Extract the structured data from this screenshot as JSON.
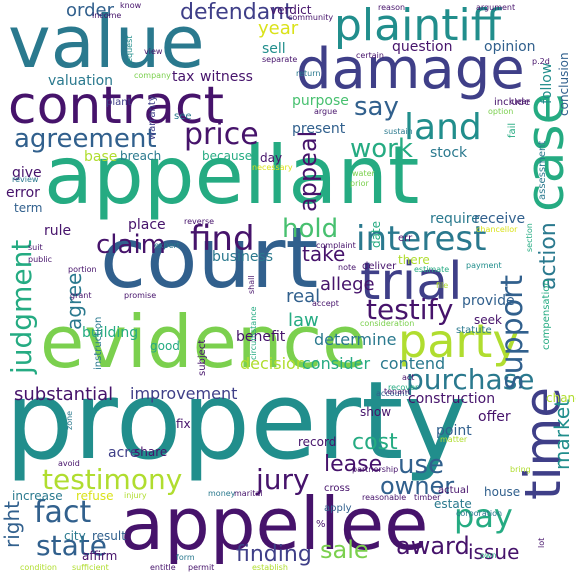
{
  "palette": {
    "dark_purple": "#46136b",
    "indigo": "#3f3f88",
    "blue": "#31608d",
    "teal_blue": "#2a798e",
    "teal": "#218e8c",
    "sea_green": "#25ab82",
    "green": "#47c06f",
    "light_green": "#7bd04e",
    "yellow_green": "#b0dd2f",
    "yellow": "#dae21a"
  },
  "words": [
    {
      "text": "value",
      "color": "#2a798e"
    },
    {
      "text": "property",
      "color": "#218e8c"
    },
    {
      "text": "appellant",
      "color": "#25ab82"
    },
    {
      "text": "court",
      "color": "#31608d"
    },
    {
      "text": "evidence",
      "color": "#7bd04e"
    },
    {
      "text": "appellee",
      "color": "#46136b"
    },
    {
      "text": "damage",
      "color": "#3f3f88"
    },
    {
      "text": "contract",
      "color": "#46136b"
    },
    {
      "text": "plaintiff",
      "color": "#218e8c"
    },
    {
      "text": "trial",
      "color": "#3f3f88"
    },
    {
      "text": "case",
      "color": "#25ab82"
    },
    {
      "text": "party",
      "color": "#b0dd2f"
    },
    {
      "text": "interest",
      "color": "#2a798e"
    },
    {
      "text": "time",
      "color": "#3f3f88"
    },
    {
      "text": "find",
      "color": "#46136b"
    },
    {
      "text": "agreement",
      "color": "#31608d"
    },
    {
      "text": "land",
      "color": "#218e8c"
    },
    {
      "text": "testimony",
      "color": "#b0dd2f"
    },
    {
      "text": "jury",
      "color": "#46136b"
    },
    {
      "text": "purchase",
      "color": "#2a798e"
    },
    {
      "text": "support",
      "color": "#31608d"
    },
    {
      "text": "testify",
      "color": "#46136b"
    },
    {
      "text": "judgment",
      "color": "#25ab82"
    },
    {
      "text": "price",
      "color": "#46136b"
    },
    {
      "text": "fact",
      "color": "#31608d"
    },
    {
      "text": "state",
      "color": "#31608d"
    },
    {
      "text": "pay",
      "color": "#25ab82"
    },
    {
      "text": "claim",
      "color": "#46136b"
    },
    {
      "text": "hold",
      "color": "#47c06f"
    },
    {
      "text": "work",
      "color": "#25ab82"
    },
    {
      "text": "say",
      "color": "#31608d"
    },
    {
      "text": "appeal",
      "color": "#46136b"
    },
    {
      "text": "owner",
      "color": "#31608d"
    },
    {
      "text": "use",
      "color": "#31608d"
    },
    {
      "text": "cost",
      "color": "#25ab82"
    },
    {
      "text": "lease",
      "color": "#46136b"
    },
    {
      "text": "action",
      "color": "#2a798e"
    },
    {
      "text": "sale",
      "color": "#7bd04e"
    },
    {
      "text": "award",
      "color": "#46136b"
    },
    {
      "text": "issue",
      "color": "#46136b"
    },
    {
      "text": "market",
      "color": "#218e8c"
    },
    {
      "text": "right",
      "color": "#31608d"
    },
    {
      "text": "finding",
      "color": "#3f3f88"
    },
    {
      "text": "defendant",
      "color": "#3f3f88"
    },
    {
      "text": "order",
      "color": "#31608d"
    },
    {
      "text": "year",
      "color": "#dae21a"
    },
    {
      "text": "take",
      "color": "#46136b"
    },
    {
      "text": "allege",
      "color": "#46136b"
    },
    {
      "text": "agree",
      "color": "#2a798e"
    },
    {
      "text": "law",
      "color": "#25ab82"
    },
    {
      "text": "real",
      "color": "#31608d"
    },
    {
      "text": "substantial",
      "color": "#46136b"
    },
    {
      "text": "improvement",
      "color": "#3f3f88"
    },
    {
      "text": "decision",
      "color": "#b0dd2f"
    },
    {
      "text": "consider",
      "color": "#25ab82"
    },
    {
      "text": "determine",
      "color": "#2a798e"
    },
    {
      "text": "contend",
      "color": "#2a798e"
    },
    {
      "text": "construction",
      "color": "#46136b"
    },
    {
      "text": "question",
      "color": "#46136b"
    },
    {
      "text": "opinion",
      "color": "#31608d"
    },
    {
      "text": "sell",
      "color": "#218e8c"
    },
    {
      "text": "valuation",
      "color": "#2a798e"
    },
    {
      "text": "tax",
      "color": "#46136b"
    },
    {
      "text": "witness",
      "color": "#46136b"
    },
    {
      "text": "purpose",
      "color": "#47c06f"
    },
    {
      "text": "present",
      "color": "#31608d"
    },
    {
      "text": "stock",
      "color": "#2a798e"
    },
    {
      "text": "base",
      "color": "#b0dd2f"
    },
    {
      "text": "breach",
      "color": "#2a798e"
    },
    {
      "text": "because",
      "color": "#25ab82"
    },
    {
      "text": "day",
      "color": "#46136b"
    },
    {
      "text": "give",
      "color": "#46136b"
    },
    {
      "text": "error",
      "color": "#46136b"
    },
    {
      "text": "term",
      "color": "#31608d"
    },
    {
      "text": "rule",
      "color": "#46136b"
    },
    {
      "text": "place",
      "color": "#46136b"
    },
    {
      "text": "business",
      "color": "#2a798e"
    },
    {
      "text": "require",
      "color": "#2a798e"
    },
    {
      "text": "receive",
      "color": "#31608d"
    },
    {
      "text": "follow",
      "color": "#218e8c"
    },
    {
      "text": "conclusion",
      "color": "#31608d"
    },
    {
      "text": "building",
      "color": "#25ab82"
    },
    {
      "text": "benefit",
      "color": "#46136b"
    },
    {
      "text": "good",
      "color": "#25ab82"
    },
    {
      "text": "offer",
      "color": "#46136b"
    },
    {
      "text": "record",
      "color": "#46136b"
    },
    {
      "text": "show",
      "color": "#46136b"
    },
    {
      "text": "point",
      "color": "#31608d"
    },
    {
      "text": "acre",
      "color": "#3f3f88"
    },
    {
      "text": "share",
      "color": "#46136b"
    },
    {
      "text": "fix",
      "color": "#46136b"
    },
    {
      "text": "increase",
      "color": "#2a798e"
    },
    {
      "text": "refuse",
      "color": "#dae21a"
    },
    {
      "text": "city",
      "color": "#2a798e"
    },
    {
      "text": "result",
      "color": "#31608d"
    },
    {
      "text": "affirm",
      "color": "#46136b"
    },
    {
      "text": "house",
      "color": "#31608d"
    },
    {
      "text": "actual",
      "color": "#46136b"
    },
    {
      "text": "estate",
      "color": "#2a798e"
    },
    {
      "text": "provide",
      "color": "#31608d"
    },
    {
      "text": "change",
      "color": "#b0dd2f"
    },
    {
      "text": "seek",
      "color": "#46136b"
    },
    {
      "text": "compensation",
      "color": "#25ab82"
    },
    {
      "text": "verdict",
      "color": "#46136b"
    },
    {
      "text": "community",
      "color": "#46136b"
    },
    {
      "text": "argument",
      "color": "#46136b"
    },
    {
      "text": "include",
      "color": "#46136b"
    },
    {
      "text": "option",
      "color": "#7bd04e"
    },
    {
      "text": "return",
      "color": "#2a798e"
    },
    {
      "text": "plant",
      "color": "#3f3f88"
    },
    {
      "text": "warranty",
      "color": "#3f3f88"
    },
    {
      "text": "see",
      "color": "#2a798e"
    },
    {
      "text": "assessment",
      "color": "#2a798e"
    },
    {
      "text": "instruction",
      "color": "#2a798e"
    },
    {
      "text": "accept",
      "color": "#46136b"
    },
    {
      "text": "subject",
      "color": "#46136b"
    },
    {
      "text": "condition",
      "color": "#b0dd2f"
    },
    {
      "text": "sufficient",
      "color": "#b0dd2f"
    },
    {
      "text": "entitle",
      "color": "#46136b"
    },
    {
      "text": "permit",
      "color": "#46136b"
    },
    {
      "text": "form",
      "color": "#2a798e"
    },
    {
      "text": "establish",
      "color": "#b0dd2f"
    },
    {
      "text": "statute",
      "color": "#2a798e"
    },
    {
      "text": "account",
      "color": "#31608d"
    },
    {
      "text": "note",
      "color": "#46136b"
    },
    {
      "text": "deliver",
      "color": "#46136b"
    },
    {
      "text": "date",
      "color": "#25ab82"
    },
    {
      "text": "there",
      "color": "#b0dd2f"
    },
    {
      "text": "err",
      "color": "#46136b"
    },
    {
      "text": "reverse",
      "color": "#46136b"
    },
    {
      "text": "partnership",
      "color": "#46136b"
    },
    {
      "text": "reasonable",
      "color": "#46136b"
    },
    {
      "text": "timber",
      "color": "#46136b"
    },
    {
      "text": "corporation",
      "color": "#2a798e"
    },
    {
      "text": "cross",
      "color": "#46136b"
    },
    {
      "text": "apply",
      "color": "#31608d"
    },
    {
      "text": "shall",
      "color": "#46136b"
    },
    {
      "text": "expert",
      "color": "#2a798e"
    },
    {
      "text": "public",
      "color": "#46136b"
    },
    {
      "text": "suit",
      "color": "#46136b"
    },
    {
      "text": "grant",
      "color": "#46136b"
    },
    {
      "text": "portion",
      "color": "#46136b"
    },
    {
      "text": "complaint",
      "color": "#46136b"
    },
    {
      "text": "estimate",
      "color": "#25ab82"
    },
    {
      "text": "payment",
      "color": "#218e8c"
    },
    {
      "text": "section",
      "color": "#25ab82"
    },
    {
      "text": "injury",
      "color": "#b0dd2f"
    },
    {
      "text": "money",
      "color": "#2a798e"
    },
    {
      "text": "marital",
      "color": "#46136b"
    },
    {
      "text": "own",
      "color": "#25ab82"
    },
    {
      "text": "lot",
      "color": "#46136b"
    },
    {
      "text": "circumstance",
      "color": "#25ab82"
    },
    {
      "text": "income",
      "color": "#46136b"
    },
    {
      "text": "know",
      "color": "#46136b"
    },
    {
      "text": "request",
      "color": "#218e8c"
    },
    {
      "text": "view",
      "color": "#46136b"
    },
    {
      "text": "company",
      "color": "#7bd04e"
    },
    {
      "text": "separate",
      "color": "#46136b"
    },
    {
      "text": "certain",
      "color": "#46136b"
    },
    {
      "text": "argue",
      "color": "#46136b"
    },
    {
      "text": "sustain",
      "color": "#2a798e"
    },
    {
      "text": "fail",
      "color": "#25ab82"
    },
    {
      "text": "prior",
      "color": "#7bd04e"
    },
    {
      "text": "water",
      "color": "#7bd04e"
    },
    {
      "text": "chancellor",
      "color": "#dae21a"
    },
    {
      "text": "necessary",
      "color": "#dae21a"
    },
    {
      "text": "review",
      "color": "#2a798e"
    },
    {
      "text": "clear",
      "color": "#46136b"
    },
    {
      "text": "consideration",
      "color": "#7bd04e"
    },
    {
      "text": "bring",
      "color": "#b0dd2f"
    },
    {
      "text": "matter",
      "color": "#b0dd2f"
    },
    {
      "text": "avoid",
      "color": "#46136b"
    },
    {
      "text": "zone",
      "color": "#2a798e"
    },
    {
      "text": "tenant",
      "color": "#46136b"
    },
    {
      "text": "file",
      "color": "#b0dd2f"
    },
    {
      "text": "reason",
      "color": "#46136b"
    },
    {
      "text": "p.2d",
      "color": "#46136b"
    },
    {
      "text": "act",
      "color": "#46136b"
    },
    {
      "text": "%",
      "color": "#46136b"
    },
    {
      "text": "promise",
      "color": "#46136b"
    },
    {
      "text": "recover",
      "color": "#25ab82"
    }
  ]
}
